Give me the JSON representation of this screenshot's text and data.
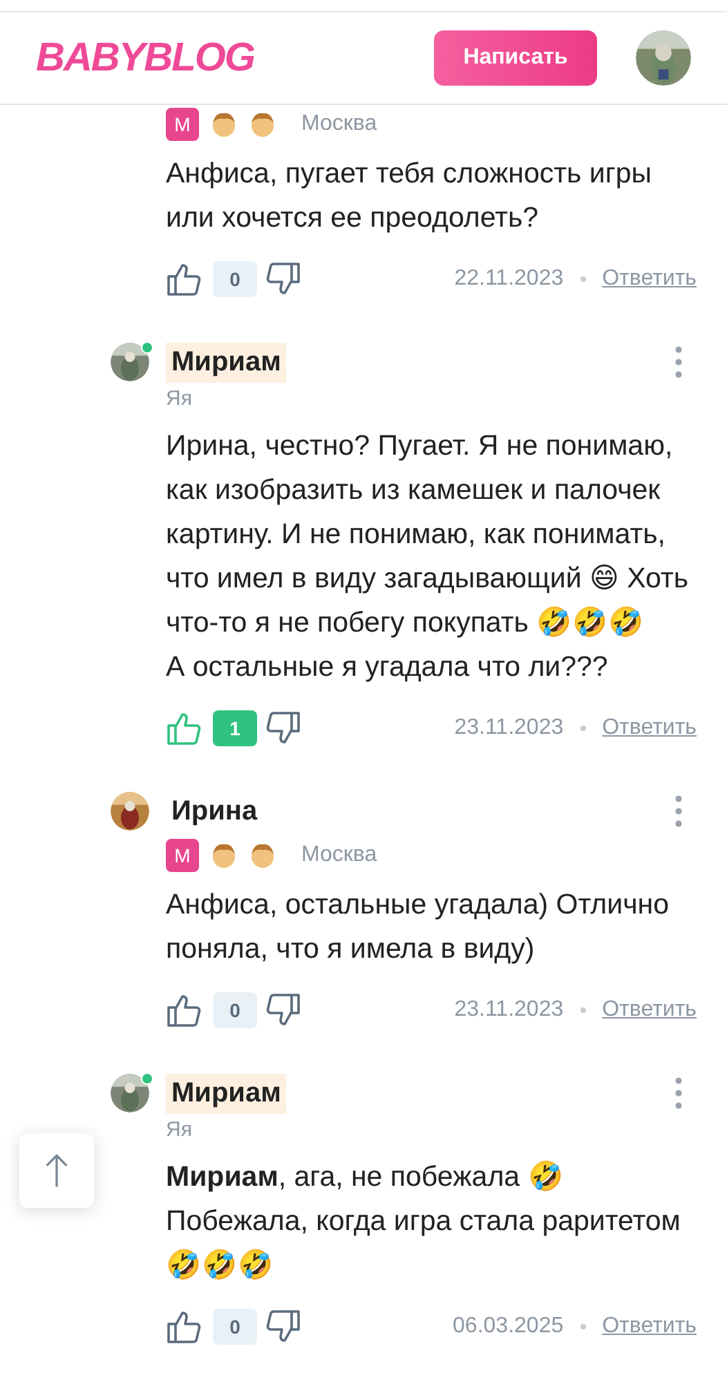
{
  "header": {
    "logo": "BABYBLOG",
    "write_button": "Написать"
  },
  "comments": [
    {
      "badges": [
        {
          "kind": "level",
          "text": "М"
        },
        {
          "kind": "child"
        },
        {
          "kind": "child"
        }
      ],
      "city": "Москва",
      "text": "Анфиса, пугает тебя сложность игры или хочется ее преодолеть?",
      "liked": false,
      "likes": "0",
      "date": "22.11.2023",
      "reply": "Ответить"
    },
    {
      "name": "Мириам",
      "online": true,
      "own": true,
      "subtitle": "Яя",
      "text": "Ирина, честно? Пугает. Я не понимаю, как изобразить из камешек и палочек картину. И не понимаю, как понимать, что имел в виду загадывающий 😄 Хоть что-то я не побегу покупать 🤣🤣🤣\nА остальные я угадала что ли???",
      "liked": true,
      "likes": "1",
      "date": "23.11.2023",
      "reply": "Ответить"
    },
    {
      "name": "Ирина",
      "online": false,
      "own": false,
      "badges": [
        {
          "kind": "level",
          "text": "М"
        },
        {
          "kind": "child"
        },
        {
          "kind": "child"
        }
      ],
      "city": "Москва",
      "text": "Анфиса, остальные угадала) Отлично поняла, что я имела в виду)",
      "liked": false,
      "likes": "0",
      "date": "23.11.2023",
      "reply": "Ответить"
    },
    {
      "name": "Мириам",
      "online": true,
      "own": true,
      "subtitle": "Яя",
      "text": "**Мириам**, ага, не побежала 🤣\nПобежала, когда игра стала раритетом 🤣🤣🤣",
      "liked": false,
      "likes": "0",
      "date": "06.03.2025",
      "reply": "Ответить"
    }
  ]
}
